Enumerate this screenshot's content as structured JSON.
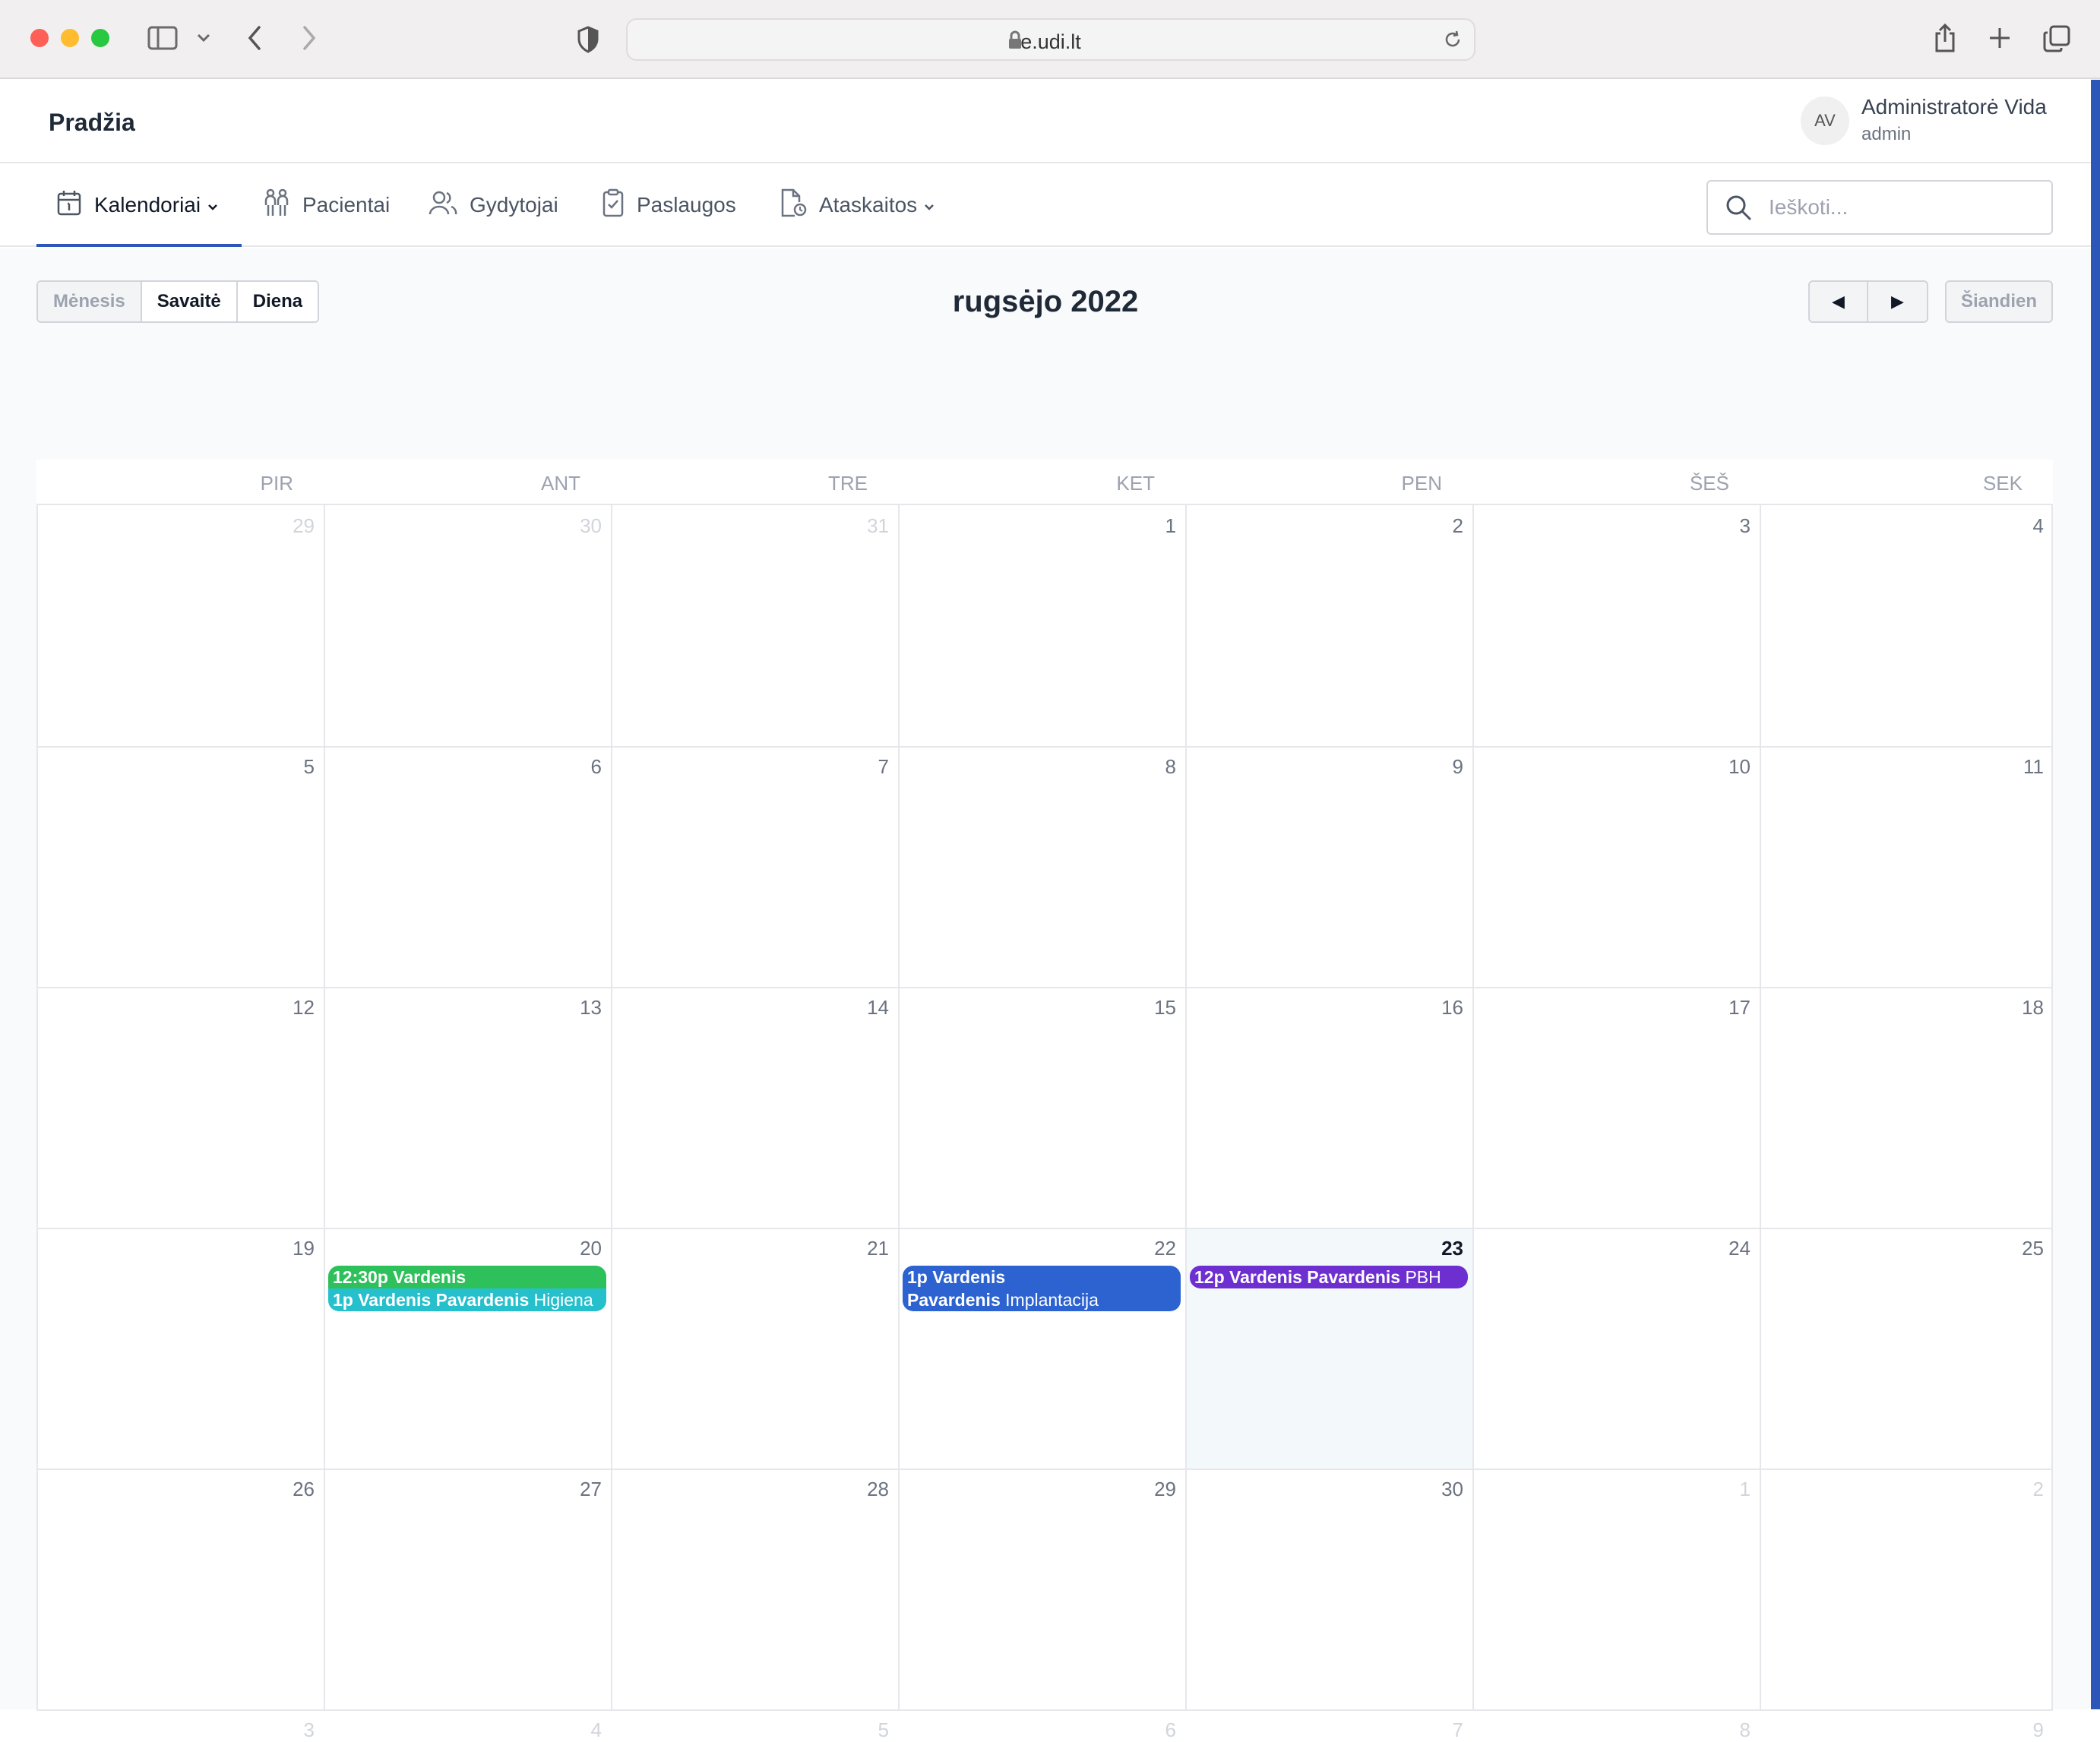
{
  "browser": {
    "url": "e.udi.lt"
  },
  "header": {
    "brand": "Pradžia",
    "avatar_initials": "AV",
    "user_name": "Administratorė Vida",
    "user_role": "admin"
  },
  "nav": {
    "items": [
      {
        "label": "Kalendoriai",
        "icon": "calendar-icon",
        "dropdown": true,
        "active": true
      },
      {
        "label": "Pacientai",
        "icon": "patients-icon",
        "dropdown": false
      },
      {
        "label": "Gydytojai",
        "icon": "doctors-icon",
        "dropdown": false
      },
      {
        "label": "Paslaugos",
        "icon": "clipboard-icon",
        "dropdown": false
      },
      {
        "label": "Ataskaitos",
        "icon": "report-icon",
        "dropdown": true
      }
    ],
    "search_placeholder": "Ieškoti..."
  },
  "calendar": {
    "views": [
      "Mėnesis",
      "Savaitė",
      "Diena"
    ],
    "title": "rugsėjo 2022",
    "prev": "◀",
    "next": "▶",
    "today": "Šiandien",
    "weekdays": [
      "PIR",
      "ANT",
      "TRE",
      "KET",
      "PEN",
      "ŠEŠ",
      "SEK"
    ],
    "weeks": [
      [
        "29",
        "30",
        "31",
        "1",
        "2",
        "3",
        "4"
      ],
      [
        "5",
        "6",
        "7",
        "8",
        "9",
        "10",
        "11"
      ],
      [
        "12",
        "13",
        "14",
        "15",
        "16",
        "17",
        "18"
      ],
      [
        "19",
        "20",
        "21",
        "22",
        "23",
        "24",
        "25"
      ],
      [
        "26",
        "27",
        "28",
        "29",
        "30",
        "1",
        "2"
      ],
      [
        "3",
        "4",
        "5",
        "6",
        "7",
        "8",
        "9"
      ]
    ],
    "events": [
      {
        "time": "12:30p",
        "title": "Vardenis",
        "service": "",
        "color": "#2ec05a"
      },
      {
        "time": "1p",
        "title": "Vardenis Pavardenis",
        "service": "Higiena",
        "color": "#26c0cc"
      },
      {
        "time": "1p",
        "title": "Vardenis",
        "title2": "Pavardenis",
        "service": "Implantacija",
        "color": "#2c63d0"
      },
      {
        "time": "12p",
        "title": "Vardenis Pavardenis",
        "service": "PBH",
        "color": "#6d2fd0"
      }
    ]
  }
}
